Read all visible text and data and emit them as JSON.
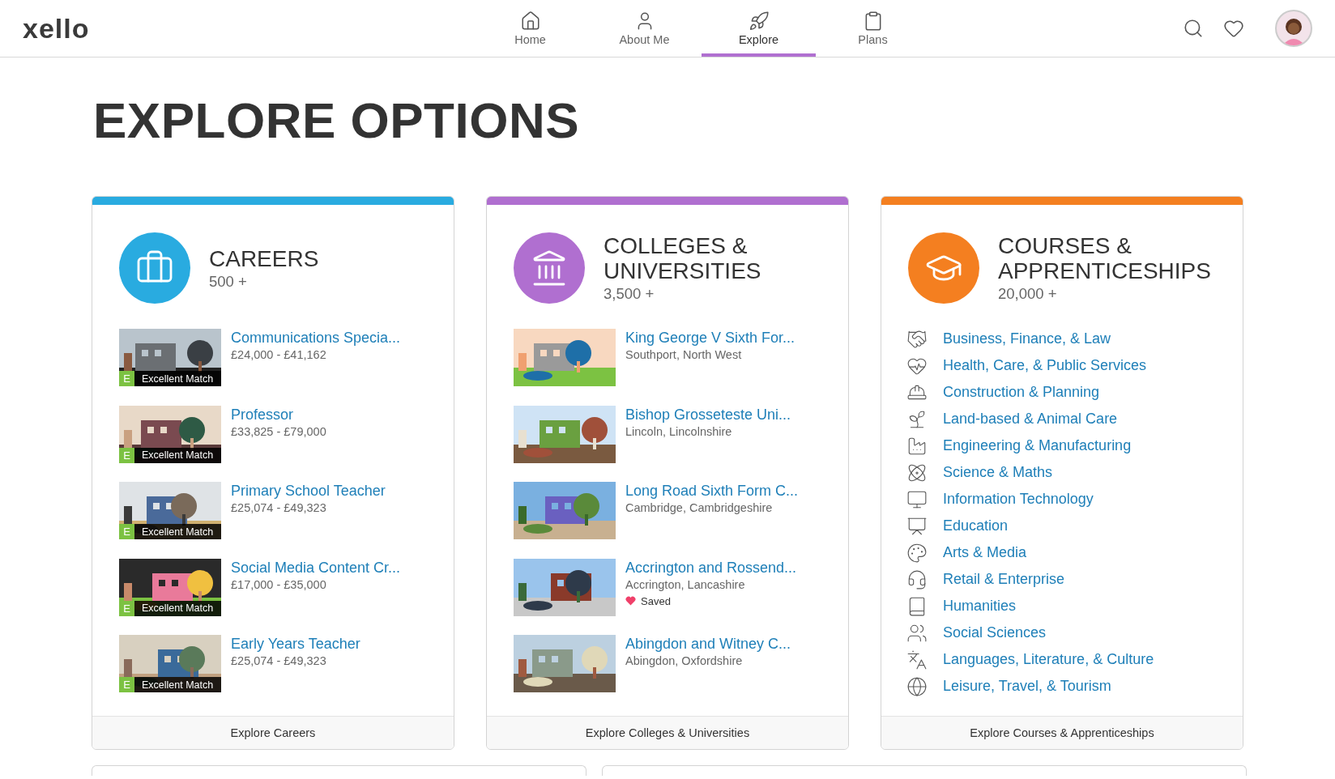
{
  "header": {
    "logo": "xello",
    "nav": [
      {
        "label": "Home",
        "selected": false
      },
      {
        "label": "About Me",
        "selected": false
      },
      {
        "label": "Explore",
        "selected": true
      },
      {
        "label": "Plans",
        "selected": false
      }
    ]
  },
  "title": "EXPLORE OPTIONS",
  "cards": [
    {
      "kind": "careers",
      "color": "#29abe0",
      "title_lines": [
        "CAREERS"
      ],
      "count": "500 +",
      "footer": "Explore Careers",
      "items": [
        {
          "title": "Communications Specia...",
          "subtitle": "£24,000 - £41,162",
          "badge_letter": "E",
          "badge": "Excellent Match"
        },
        {
          "title": "Professor",
          "subtitle": "£33,825 - £79,000",
          "badge_letter": "E",
          "badge": "Excellent Match"
        },
        {
          "title": "Primary School Teacher",
          "subtitle": "£25,074 - £49,323",
          "badge_letter": "E",
          "badge": "Excellent Match"
        },
        {
          "title": "Social Media Content Cr...",
          "subtitle": "£17,000 - £35,000",
          "badge_letter": "E",
          "badge": "Excellent Match"
        },
        {
          "title": "Early Years Teacher",
          "subtitle": "£25,074 - £49,323",
          "badge_letter": "E",
          "badge": "Excellent Match"
        }
      ]
    },
    {
      "kind": "places",
      "color": "#b06fd0",
      "title_lines": [
        "COLLEGES &",
        "UNIVERSITIES"
      ],
      "count": "3,500 +",
      "footer": "Explore Colleges & Universities",
      "items": [
        {
          "title": "King George V Sixth For...",
          "subtitle": "Southport, North West",
          "saved": false
        },
        {
          "title": "Bishop Grosseteste Uni...",
          "subtitle": "Lincoln, Lincolnshire",
          "saved": false
        },
        {
          "title": "Long Road Sixth Form C...",
          "subtitle": "Cambridge, Cambridgeshire",
          "saved": false
        },
        {
          "title": "Accrington and Rossend...",
          "subtitle": "Accrington, Lancashire",
          "saved": true,
          "saved_label": "Saved"
        },
        {
          "title": "Abingdon and Witney C...",
          "subtitle": "Abingdon, Oxfordshire",
          "saved": false
        }
      ]
    },
    {
      "kind": "categories",
      "color": "#f47f20",
      "title_lines": [
        "COURSES &",
        "APPRENTICESHIPS"
      ],
      "count": "20,000 +",
      "footer": "Explore Courses & Apprenticeships",
      "items": [
        {
          "title": "Business, Finance, & Law"
        },
        {
          "title": "Health, Care, & Public Services"
        },
        {
          "title": "Construction & Planning"
        },
        {
          "title": "Land-based & Animal Care"
        },
        {
          "title": "Engineering & Manufacturing"
        },
        {
          "title": "Science & Maths"
        },
        {
          "title": "Information Technology"
        },
        {
          "title": "Education"
        },
        {
          "title": "Arts & Media"
        },
        {
          "title": "Retail & Enterprise"
        },
        {
          "title": "Humanities"
        },
        {
          "title": "Social Sciences"
        },
        {
          "title": "Languages, Literature, & Culture"
        },
        {
          "title": "Leisure, Travel, & Tourism"
        }
      ]
    }
  ]
}
